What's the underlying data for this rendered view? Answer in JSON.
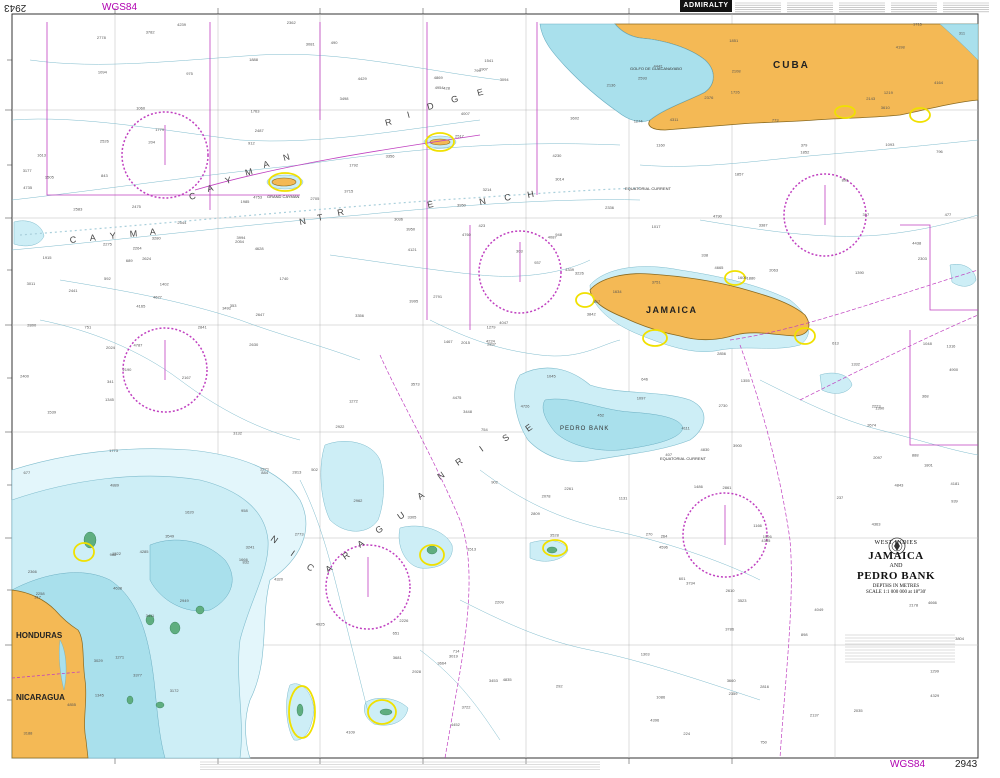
{
  "chart_number": "2943",
  "datum": "WGS84",
  "publisher": "ADMIRALTY",
  "title": {
    "region": "WEST INDIES",
    "line1": "JAMAICA",
    "line2": "AND",
    "line3": "PEDRO BANK",
    "depths": "DEPTHS IN METRES",
    "scale": "SCALE 1:1 000 000 at 18°30'"
  },
  "land_labels": {
    "cuba": "CUBA",
    "jamaica": "JAMAICA",
    "honduras": "HONDURAS",
    "nicaragua": "NICARAGUA"
  },
  "feature_labels": {
    "cayman_ridge": [
      "C",
      "A",
      "Y",
      "M",
      "A",
      "N",
      "R",
      "I",
      "D",
      "G",
      "E"
    ],
    "cayman_trench": [
      "C",
      "A",
      "Y",
      "M",
      "A",
      "N",
      "T",
      "R",
      "E",
      "N",
      "C",
      "H"
    ],
    "nicaraguan_rise": [
      "N",
      "I",
      "C",
      "A",
      "R",
      "A",
      "G",
      "U",
      "A",
      "N",
      "R",
      "I",
      "S",
      "E"
    ],
    "pedro_bank": "PEDRO BANK",
    "grand_cayman": "GRAND CAYMAN",
    "golfo": "GOLFO DE GUACANAYABO",
    "equatorial_current": "EQUATORIAL CURRENT"
  },
  "colors": {
    "land": "#f4b955",
    "shallow": "#a9e0ec",
    "mid": "#cdeef6",
    "deep_shelf": "#e3f6fb",
    "sea": "#ffffff",
    "magenta": "#c040c0",
    "contour": "#7fbccd",
    "highlight": "#f0e000",
    "reef": "#5fae80"
  }
}
